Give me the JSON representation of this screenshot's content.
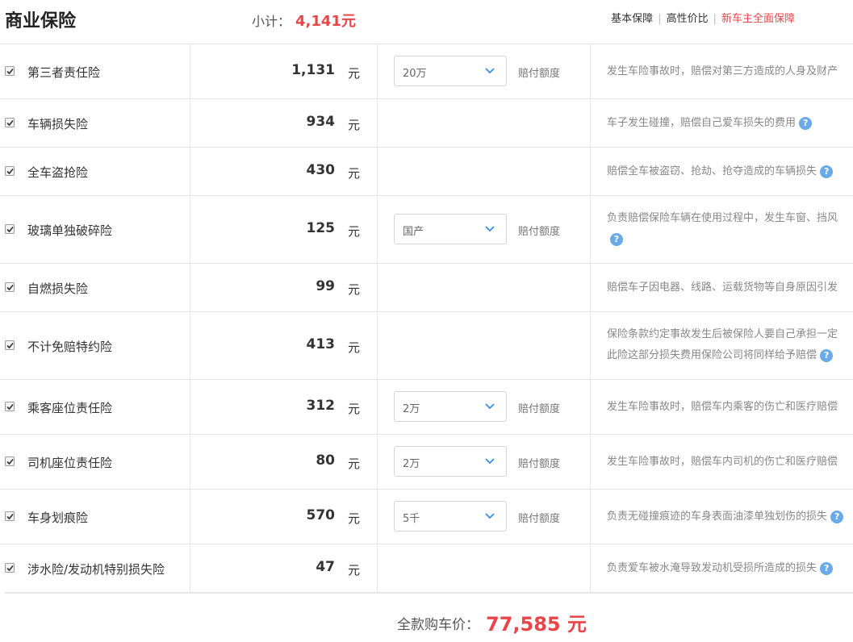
{
  "header": {
    "title": "商业保险",
    "subtotal_label": "小计：",
    "subtotal_value": "4,141元",
    "plans": [
      "基本保障",
      "高性价比",
      "新车主全面保障"
    ]
  },
  "currency_unit": "元",
  "limit_label": "赔付额度",
  "rows": [
    {
      "name": "第三者责任险",
      "price": "1,131",
      "select": "20万",
      "desc": "发生车险事故时，赔偿对第三方造成的人身及财产"
    },
    {
      "name": "车辆损失险",
      "price": "934",
      "desc": "车子发生碰撞，赔偿自己爱车损失的费用"
    },
    {
      "name": "全车盗抢险",
      "price": "430",
      "desc": "赔偿全车被盗窃、抢劫、抢夺造成的车辆损失"
    },
    {
      "name": "玻璃单独破碎险",
      "price": "125",
      "select": "国产",
      "desc": "负责赔偿保险车辆在使用过程中，发生车窗、挡风"
    },
    {
      "name": "自燃损失险",
      "price": "99",
      "desc": "赔偿车子因电器、线路、运载货物等自身原因引发"
    },
    {
      "name": "不计免赔特约险",
      "price": "413",
      "desc": "保险条款约定事故发生后被保险人要自己承担一定",
      "desc2": "此险这部分损失费用保险公司将同样给予赔偿"
    },
    {
      "name": "乘客座位责任险",
      "price": "312",
      "select": "2万",
      "desc": "发生车险事故时，赔偿车内乘客的伤亡和医疗赔偿"
    },
    {
      "name": "司机座位责任险",
      "price": "80",
      "select": "2万",
      "desc": "发生车险事故时，赔偿车内司机的伤亡和医疗赔偿"
    },
    {
      "name": "车身划痕险",
      "price": "570",
      "select": "5千",
      "desc": "负责无碰撞痕迹的车身表面油漆单独划伤的损失"
    },
    {
      "name": "涉水险/发动机特别损失险",
      "price": "47",
      "desc": "负责爱车被水淹导致发动机受损所造成的损失"
    }
  ],
  "footer": {
    "total_label": "全款购车价：",
    "total_value": "77,585 元"
  },
  "colors": {
    "accent": "#e8464a",
    "help": "#6aaae8",
    "border": "#e6e6e6"
  }
}
